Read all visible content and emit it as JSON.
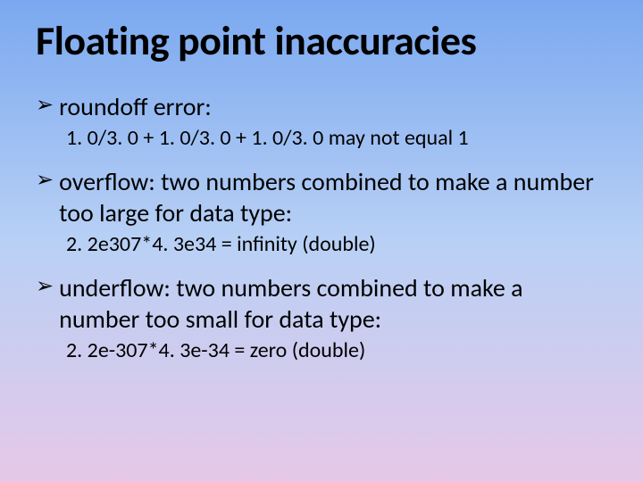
{
  "title": "Floating point inaccuracies",
  "items": [
    {
      "label": "roundoff error:",
      "sub": "1. 0/3. 0 + 1. 0/3. 0 + 1. 0/3. 0 may not equal 1"
    },
    {
      "label": "overflow: two numbers combined to make a number too large for data type:",
      "sub": "2. 2e307*4. 3e34 = infinity (double)"
    },
    {
      "label": "underflow: two numbers combined to make a number too small for data type:",
      "sub": "2. 2e-307*4. 3e-34 = zero (double)"
    }
  ]
}
